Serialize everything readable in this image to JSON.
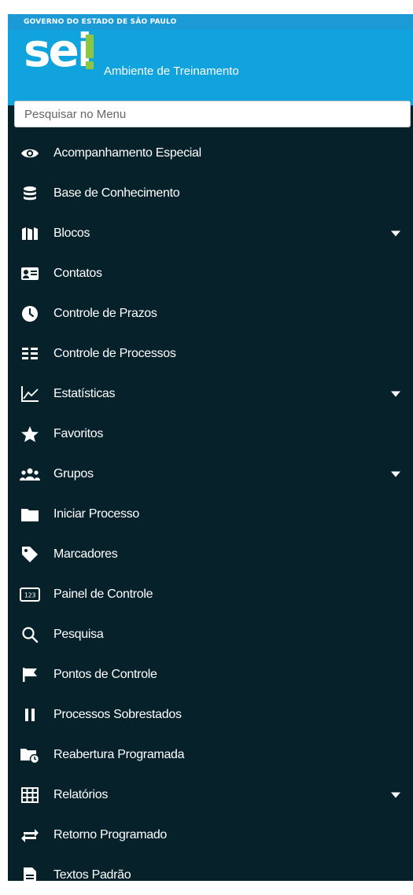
{
  "header": {
    "government_label": "GOVERNO DO ESTADO DE SÃO PAULO",
    "logo_text": "sei",
    "environment_label": "Ambiente de Treinamento"
  },
  "search": {
    "placeholder": "Pesquisar no Menu",
    "value": ""
  },
  "menu": {
    "items": [
      {
        "label": "Acompanhamento Especial",
        "icon": "eye-icon",
        "submenu": false
      },
      {
        "label": "Base de Conhecimento",
        "icon": "database-icon",
        "submenu": false
      },
      {
        "label": "Blocos",
        "icon": "blocks-icon",
        "submenu": true
      },
      {
        "label": "Contatos",
        "icon": "contact-card-icon",
        "submenu": false
      },
      {
        "label": "Controle de Prazos",
        "icon": "clock-icon",
        "submenu": false
      },
      {
        "label": "Controle de Processos",
        "icon": "list-icon",
        "submenu": false
      },
      {
        "label": "Estatísticas",
        "icon": "line-chart-icon",
        "submenu": true
      },
      {
        "label": "Favoritos",
        "icon": "star-icon",
        "submenu": false
      },
      {
        "label": "Grupos",
        "icon": "users-icon",
        "submenu": true
      },
      {
        "label": "Iniciar Processo",
        "icon": "folder-icon",
        "submenu": false
      },
      {
        "label": "Marcadores",
        "icon": "tag-icon",
        "submenu": false
      },
      {
        "label": "Painel de Controle",
        "icon": "numbers-panel-icon",
        "submenu": false
      },
      {
        "label": "Pesquisa",
        "icon": "search-icon",
        "submenu": false
      },
      {
        "label": "Pontos de Controle",
        "icon": "flag-icon",
        "submenu": false
      },
      {
        "label": "Processos Sobrestados",
        "icon": "pause-icon",
        "submenu": false
      },
      {
        "label": "Reabertura Programada",
        "icon": "folder-clock-icon",
        "submenu": false
      },
      {
        "label": "Relatórios",
        "icon": "table-icon",
        "submenu": true
      },
      {
        "label": "Retorno Programado",
        "icon": "exchange-arrows-icon",
        "submenu": false
      },
      {
        "label": "Textos Padrão",
        "icon": "document-icon",
        "submenu": false
      }
    ]
  },
  "colors": {
    "gov_bar": "#1b9ad6",
    "brand_bar": "#11a3dd",
    "menu_background": "#07212b",
    "logo_accent": "#8cc63f",
    "text": "#ffffff"
  }
}
